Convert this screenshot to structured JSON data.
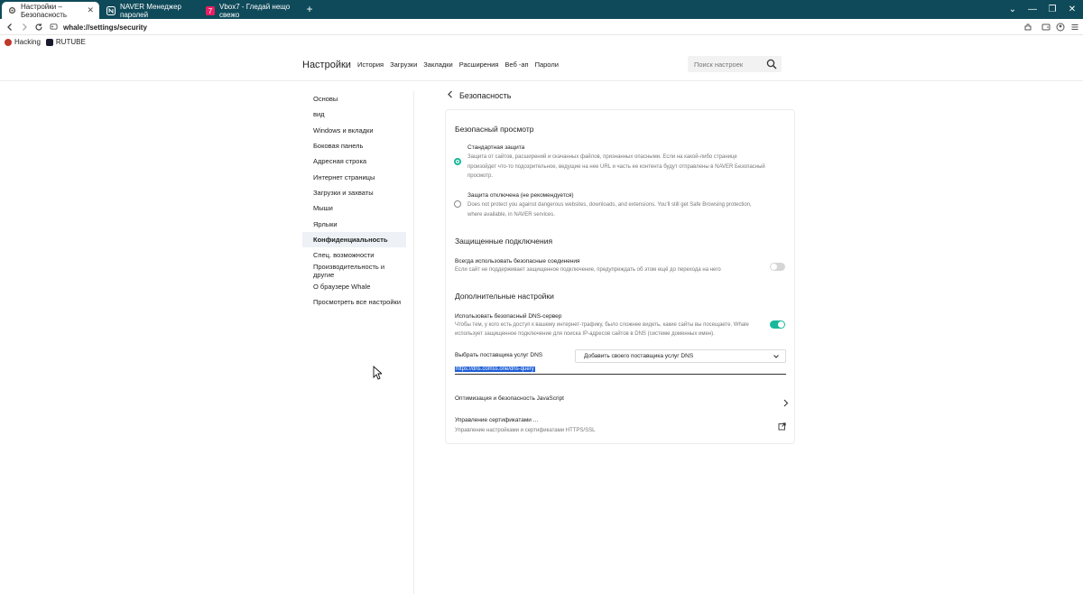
{
  "tabs": [
    {
      "title": "Настройки – Безопасность",
      "active": true
    },
    {
      "title": "NAVER Менеджер паролей",
      "active": false
    },
    {
      "title": "Vbox7 - Гледай нещо свежо",
      "active": false
    }
  ],
  "address": {
    "url": "whale://settings/security"
  },
  "bookmarks": [
    {
      "label": "Hacking",
      "color": "#c0392b"
    },
    {
      "label": "RUTUBE",
      "color": "#1a1a2e"
    }
  ],
  "header": {
    "title": "Настройки",
    "nav": [
      "История",
      "Загрузки",
      "Закладки",
      "Расширения",
      "Веб -ап",
      "Пароли"
    ],
    "search_placeholder": "Поиск настроек"
  },
  "sidebar": {
    "items": [
      "Основы",
      "вид",
      "Windows и вкладки",
      "Боковая панель",
      "Адресная строка",
      "Интернет страницы",
      "Загрузки и захваты",
      "Мыши",
      "Ярлыки",
      "Конфиденциальность",
      "Спец. возможности",
      "Производительность и другие",
      "О браузере Whale",
      "Просмотреть все настройки"
    ],
    "active_index": 9
  },
  "page": {
    "back_label": "Безопасность"
  },
  "safe_browsing": {
    "title": "Безопасный просмотр",
    "standard_title": "Стандартная защита",
    "standard_desc": "Защита от сайтов, расширений и скачанных файлов, признанных опасными. Если на какой-либо странице произойдет что-то подозрительное, ведущие на нее URL и часть ее контента будут отправлены в NAVER Безопасный просмотр.",
    "off_title": "Защита отключена (не рекомендуется)",
    "off_desc": "Does not protect you against dangerous websites, downloads, and extensions. You'll still get Safe Browsing protection, where available, in NAVER services."
  },
  "secure_connections": {
    "title": "Защищенные подключения",
    "https_title": "Всегда использовать безопасные соединения",
    "https_desc": "Если сайт не поддерживает защищенное подключение, предупреждать об этом ещё до перехода на него"
  },
  "advanced": {
    "title": "Дополнительные настройки",
    "dns_title": "Использовать безопасный DNS-сервер",
    "dns_desc": "Чтобы тем, у кого есть доступ к вашему интернет-трафику, было сложнее видеть, какие сайты вы посещаете. Whale использует защищенное подключение для поиска IP-адресов сайтов в DNS (системе доменных имен).",
    "dns_provider_label": "Выбрать поставщика услуг DNS",
    "dns_provider_value": "Добавить своего поставщика услуг DNS",
    "dns_url": "https://dns.comss.one/dns-query",
    "js_title": "Оптимизация и безопасность JavaScript",
    "cert_title": "Управление сертификатами ...",
    "cert_desc": "Управление настройками и сертификатами HTTPS/SSL"
  },
  "colors": {
    "accent": "#18b89a",
    "tabstrip": "#0f4a5a",
    "selection": "#1f5fd6"
  }
}
